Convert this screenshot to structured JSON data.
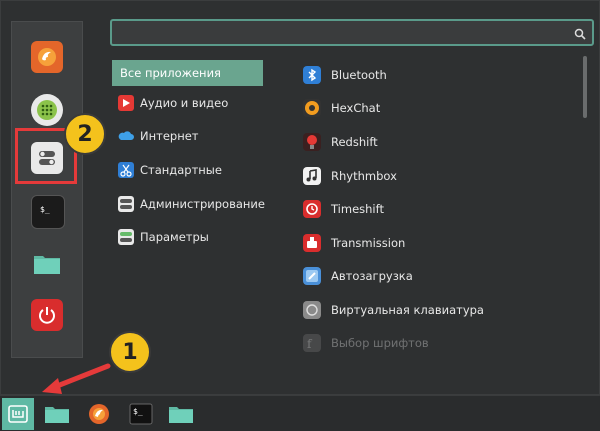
{
  "search": {
    "value": "",
    "placeholder": ""
  },
  "categories": [
    {
      "label": "Все приложения",
      "icon": "none"
    },
    {
      "label": "Аудио и видео",
      "icon": "play-icon"
    },
    {
      "label": "Интернет",
      "icon": "cloud-icon"
    },
    {
      "label": "Стандартные",
      "icon": "scissors-icon"
    },
    {
      "label": "Администрирование",
      "icon": "toggle-icon"
    },
    {
      "label": "Параметры",
      "icon": "settings-icon"
    }
  ],
  "apps": [
    {
      "label": "Bluetooth",
      "icon": "bluetooth-icon"
    },
    {
      "label": "HexChat",
      "icon": "hexchat-icon"
    },
    {
      "label": "Redshift",
      "icon": "redshift-icon"
    },
    {
      "label": "Rhythmbox",
      "icon": "rhythmbox-icon"
    },
    {
      "label": "Timeshift",
      "icon": "timeshift-icon"
    },
    {
      "label": "Transmission",
      "icon": "transmission-icon"
    },
    {
      "label": "Автозагрузка",
      "icon": "autostart-icon"
    },
    {
      "label": "Виртуальная клавиатура",
      "icon": "keyboard-icon"
    },
    {
      "label": "Выбор шрифтов",
      "icon": "font-icon"
    }
  ],
  "annotations": {
    "badge1": "1",
    "badge2": "2"
  },
  "colors": {
    "accent": "#6aa58f",
    "highlight": "#e53a3a",
    "badge": "#f4c21c"
  }
}
